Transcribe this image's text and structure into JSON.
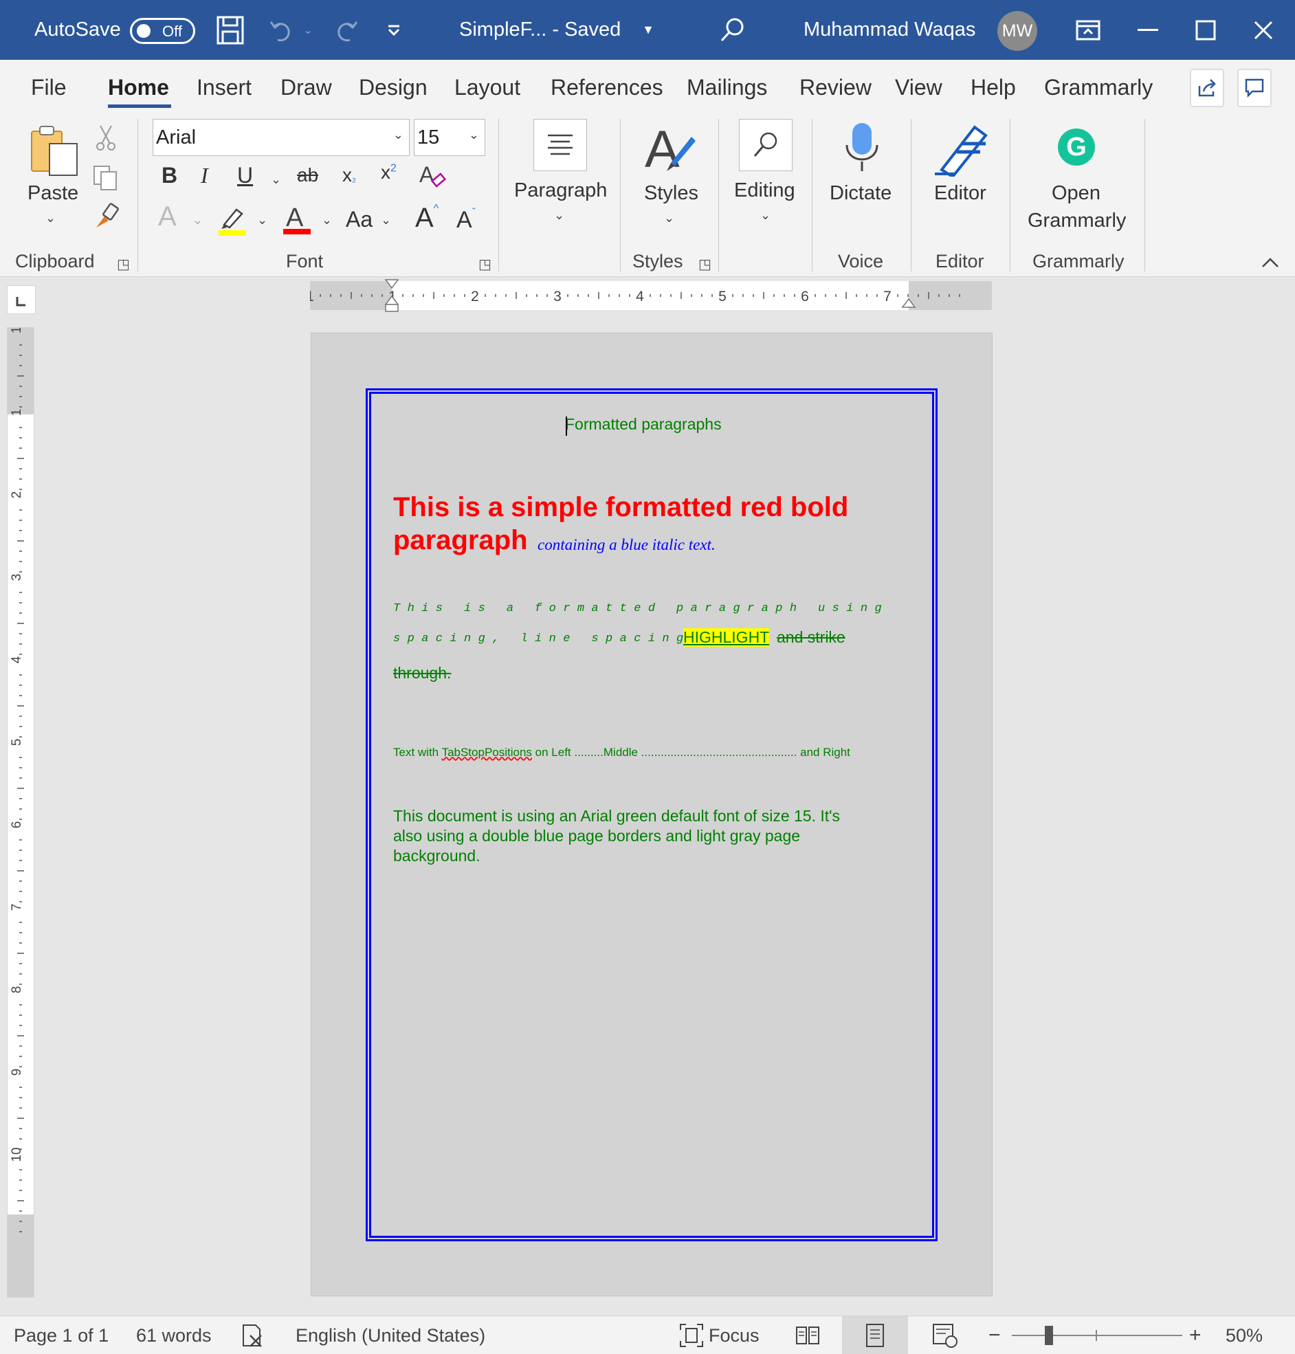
{
  "titlebar": {
    "autosave_label": "AutoSave",
    "autosave_state": "Off",
    "doc_title": "SimpleF...  -  Saved",
    "user_name": "Muhammad Waqas",
    "user_initials": "MW"
  },
  "tabs": [
    "File",
    "Home",
    "Insert",
    "Draw",
    "Design",
    "Layout",
    "References",
    "Mailings",
    "Review",
    "View",
    "Help",
    "Grammarly"
  ],
  "ribbon": {
    "clipboard": {
      "paste": "Paste",
      "group": "Clipboard"
    },
    "font": {
      "name": "Arial",
      "size": "15",
      "group": "Font",
      "case_label": "Aa"
    },
    "paragraph": {
      "label": "Paragraph"
    },
    "styles": {
      "label": "Styles",
      "group": "Styles"
    },
    "editing": {
      "label": "Editing"
    },
    "voice": {
      "label": "Dictate",
      "group": "Voice"
    },
    "editor": {
      "label": "Editor",
      "group": "Editor"
    },
    "grammarly": {
      "label1": "Open",
      "label2": "Grammarly",
      "group": "Grammarly"
    }
  },
  "ruler": {
    "h_numbers": [
      "1",
      "1",
      "2",
      "3",
      "4",
      "5",
      "6",
      "7"
    ],
    "v_numbers": [
      "1",
      "1",
      "2",
      "3",
      "4",
      "5",
      "6",
      "7",
      "8",
      "9",
      "10"
    ]
  },
  "document": {
    "header": "Formatted paragraphs",
    "red_bold_line1": "This is a simple formatted red bold",
    "red_bold_line2": "paragraph",
    "blue_italic": "containing a blue italic text.",
    "spaced_line1": "This is a formatted paragraph using",
    "spaced_line2": "spacing, line spacing,",
    "highlight": "HIGHLIGHT",
    "strike1": " and strike",
    "strike2": "through.",
    "tab_prefix": "Text with ",
    "tab_misspelled": "TabStopPositions",
    "tab_suffix": " on Left .........Middle ................................................ and Right",
    "body_line1": "This document is using an Arial green default font of size 15. It's",
    "body_line2": "also using a double blue page borders and light gray page",
    "body_line3": "background.",
    "colors": {
      "green": "#008000",
      "red": "#ff0000",
      "blue": "#0000ff",
      "highlight": "#ffff00",
      "page_bg": "#d3d3d3"
    }
  },
  "status": {
    "page": "Page 1 of 1",
    "words": "61 words",
    "language": "English (United States)",
    "focus": "Focus",
    "zoom": "50%"
  },
  "icons": [
    "save-icon",
    "undo-icon",
    "redo-icon",
    "customize-icon",
    "search-icon",
    "ribbon-display-icon",
    "minimize-icon",
    "maximize-icon",
    "close-icon",
    "share-icon",
    "comments-icon",
    "paste-icon",
    "cut-icon",
    "copy-icon",
    "format-painter-icon",
    "paragraph-icon",
    "styles-icon",
    "editing-icon",
    "dictate-icon",
    "editor-icon",
    "grammarly-icon",
    "collapse-ribbon-icon",
    "proofing-icon",
    "focus-icon",
    "read-mode-icon",
    "print-layout-icon",
    "web-layout-icon"
  ]
}
